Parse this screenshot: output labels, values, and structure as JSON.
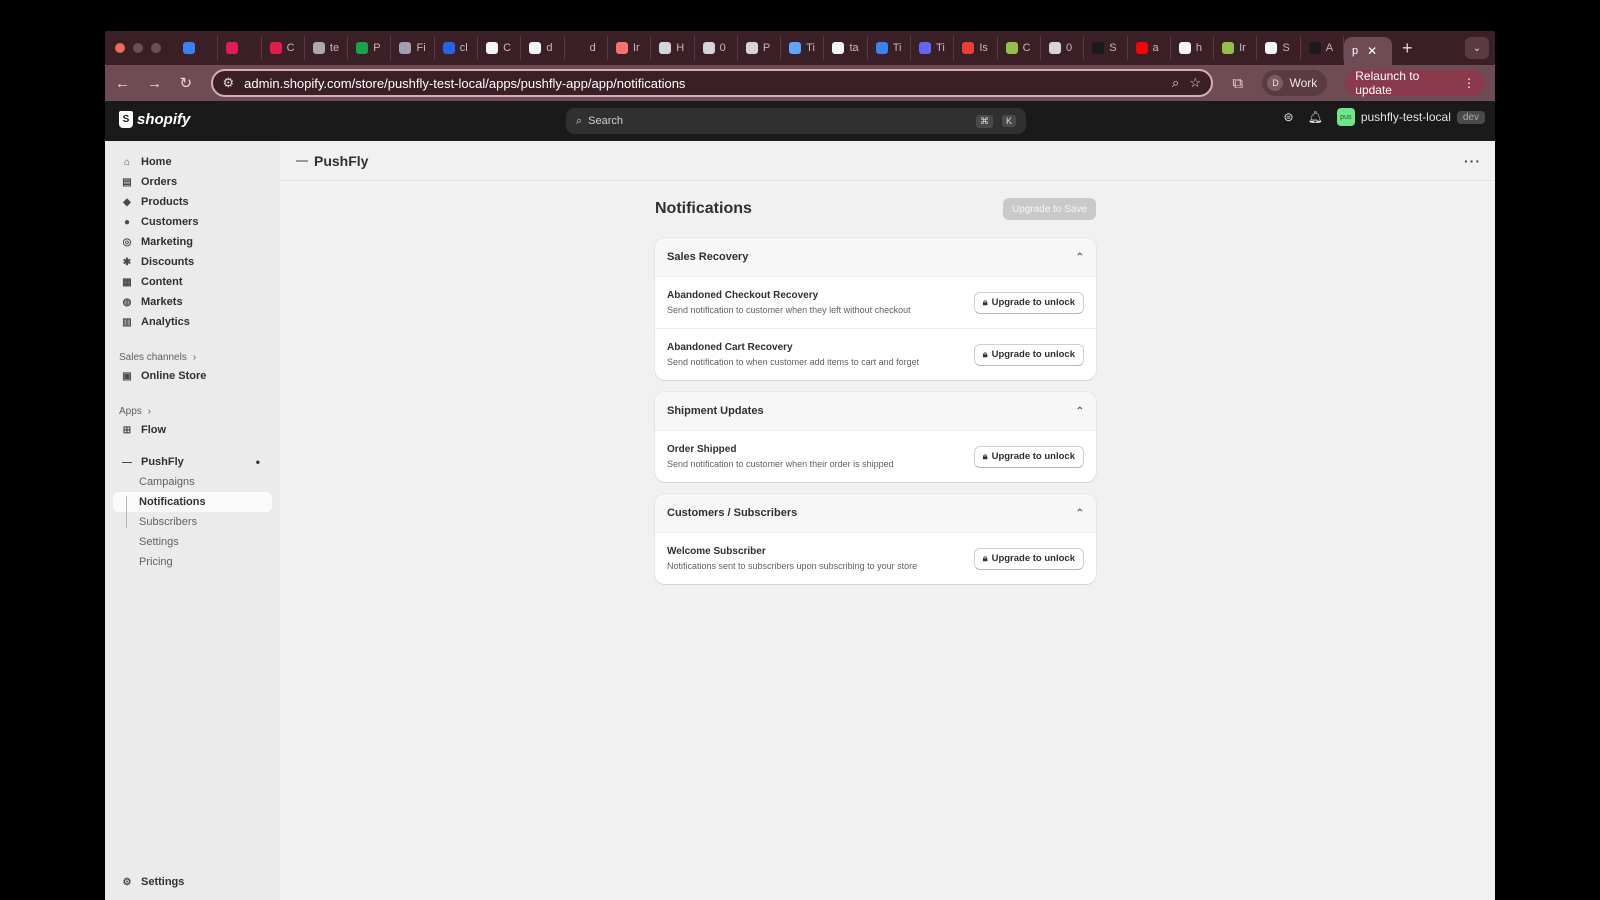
{
  "browser": {
    "tabs": [
      {
        "label": "",
        "color": "#3b82f6"
      },
      {
        "label": "",
        "color": "#e01e5a"
      },
      {
        "label": "C",
        "color": "#e11d48"
      },
      {
        "label": "te",
        "color": "#aaaaaa"
      },
      {
        "label": "P",
        "color": "#16a34a"
      },
      {
        "label": "Fi",
        "color": "#9ca3af"
      },
      {
        "label": "cl",
        "color": "#2563eb"
      },
      {
        "label": "C",
        "color": "#f5f5f5"
      },
      {
        "label": "d",
        "color": "#f5f5f5"
      },
      {
        "label": "d",
        "color": "#3b1f26"
      },
      {
        "label": "Ir",
        "color": "#f87171"
      },
      {
        "label": "H",
        "color": "#d1d5db"
      },
      {
        "label": "0",
        "color": "#d1d5db"
      },
      {
        "label": "P",
        "color": "#d1d5db"
      },
      {
        "label": "Ti",
        "color": "#60a5fa"
      },
      {
        "label": "ta",
        "color": "#f5f5f5"
      },
      {
        "label": "Ti",
        "color": "#3b82f6"
      },
      {
        "label": "Ti",
        "color": "#6366f1"
      },
      {
        "label": "Is",
        "color": "#ea4335"
      },
      {
        "label": "C",
        "color": "#95bf47"
      },
      {
        "label": "0",
        "color": "#d1d5db"
      },
      {
        "label": "S",
        "color": "#1a1a1a"
      },
      {
        "label": "a",
        "color": "#ff0000"
      },
      {
        "label": "h",
        "color": "#f5f5f5"
      },
      {
        "label": "Ir",
        "color": "#95bf47"
      },
      {
        "label": "S",
        "color": "#f5f5f5"
      },
      {
        "label": "A",
        "color": "#1a1a1a"
      }
    ],
    "active_tab": {
      "label": "p",
      "close": "✕"
    },
    "new_tab": "+",
    "tab_menu": "⌄",
    "url": "admin.shopify.com/store/pushfly-test-local/apps/pushfly-app/app/notifications",
    "profile_initial": "D",
    "profile_name": "Work",
    "relaunch": "Relaunch to update"
  },
  "shopify": {
    "logo": "shopify",
    "search_placeholder": "Search",
    "kbd_cmd": "⌘",
    "kbd_k": "K",
    "store_initials": "pus",
    "store_name": "pushfly-test-local",
    "store_tag": "dev"
  },
  "sidebar": {
    "items": [
      {
        "label": "Home",
        "icon": "⌂"
      },
      {
        "label": "Orders",
        "icon": "▤"
      },
      {
        "label": "Products",
        "icon": "◆"
      },
      {
        "label": "Customers",
        "icon": "●"
      },
      {
        "label": "Marketing",
        "icon": "◎"
      },
      {
        "label": "Discounts",
        "icon": "✱"
      },
      {
        "label": "Content",
        "icon": "▦"
      },
      {
        "label": "Markets",
        "icon": "◍"
      },
      {
        "label": "Analytics",
        "icon": "▥"
      }
    ],
    "sales_channels_label": "Sales channels",
    "online_store": "Online Store",
    "apps_label": "Apps",
    "flow": "Flow",
    "pushfly": "PushFly",
    "pushfly_sub": [
      "Campaigns",
      "Notifications",
      "Subscribers",
      "Settings",
      "Pricing"
    ],
    "settings": "Settings"
  },
  "app": {
    "name": "PushFly",
    "more": "···"
  },
  "page": {
    "title": "Notifications",
    "save_button": "Upgrade to Save",
    "unlock_label": "Upgrade to unlock",
    "sections": [
      {
        "title": "Sales Recovery",
        "rows": [
          {
            "name": "Abandoned Checkout Recovery",
            "desc": "Send notification to customer when they left without checkout"
          },
          {
            "name": "Abandoned Cart Recovery",
            "desc": "Send notification to when customer add items to cart and forget"
          }
        ]
      },
      {
        "title": "Shipment Updates",
        "rows": [
          {
            "name": "Order Shipped",
            "desc": "Send notification to customer when their order is shipped"
          }
        ]
      },
      {
        "title": "Customers / Subscribers",
        "rows": [
          {
            "name": "Welcome Subscriber",
            "desc": "Notifications sent to subscribers upon subscribing to your store"
          }
        ]
      }
    ]
  }
}
